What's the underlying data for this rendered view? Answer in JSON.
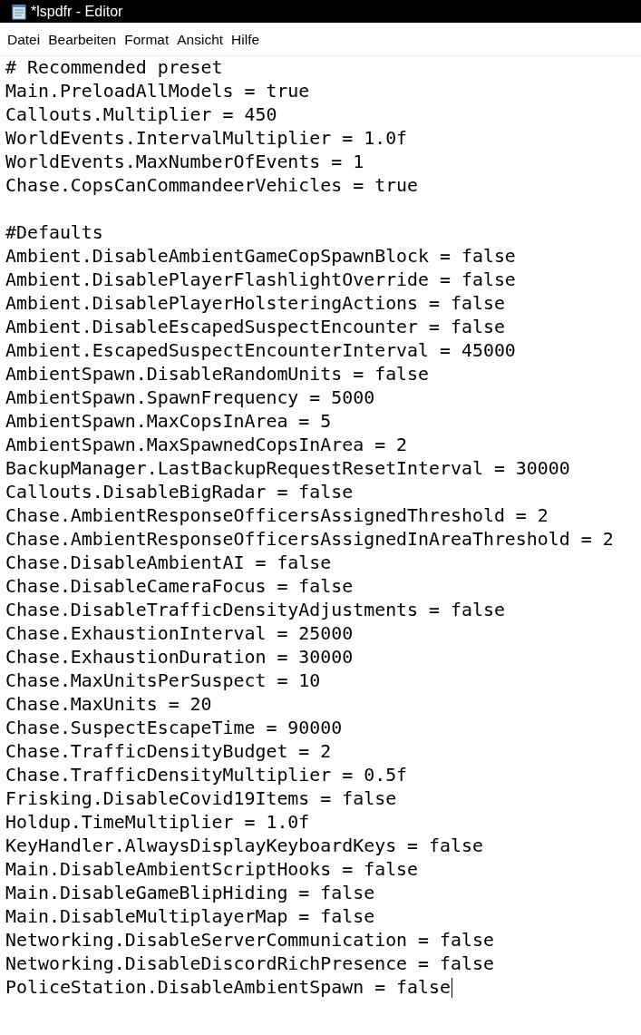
{
  "window": {
    "title": "*lspdfr - Editor"
  },
  "menu": [
    "Datei",
    "Bearbeiten",
    "Format",
    "Ansicht",
    "Hilfe"
  ],
  "editor": {
    "caret_visible": true,
    "sections": [
      {
        "lines": [
          "# Recommended preset",
          "Main.PreloadAllModels = true",
          "Callouts.Multiplier = 450",
          "WorldEvents.IntervalMultiplier = 1.0f",
          "WorldEvents.MaxNumberOfEvents = 1",
          "Chase.CopsCanCommandeerVehicles = true"
        ]
      },
      {
        "lines": [
          "#Defaults",
          "Ambient.DisableAmbientGameCopSpawnBlock = false",
          "Ambient.DisablePlayerFlashlightOverride = false",
          "Ambient.DisablePlayerHolsteringActions = false",
          "Ambient.DisableEscapedSuspectEncounter = false",
          "Ambient.EscapedSuspectEncounterInterval = 45000",
          "AmbientSpawn.DisableRandomUnits = false",
          "AmbientSpawn.SpawnFrequency = 5000",
          "AmbientSpawn.MaxCopsInArea = 5",
          "AmbientSpawn.MaxSpawnedCopsInArea = 2",
          "BackupManager.LastBackupRequestResetInterval = 30000",
          "Callouts.DisableBigRadar = false",
          "Chase.AmbientResponseOfficersAssignedThreshold = 2",
          "Chase.AmbientResponseOfficersAssignedInAreaThreshold = 2",
          "Chase.DisableAmbientAI = false",
          "Chase.DisableCameraFocus = false",
          "Chase.DisableTrafficDensityAdjustments = false",
          "Chase.ExhaustionInterval = 25000",
          "Chase.ExhaustionDuration = 30000",
          "Chase.MaxUnitsPerSuspect = 10",
          "Chase.MaxUnits = 20",
          "Chase.SuspectEscapeTime = 90000",
          "Chase.TrafficDensityBudget = 2",
          "Chase.TrafficDensityMultiplier = 0.5f",
          "Frisking.DisableCovid19Items = false",
          "Holdup.TimeMultiplier = 1.0f",
          "KeyHandler.AlwaysDisplayKeyboardKeys = false",
          "Main.DisableAmbientScriptHooks = false",
          "Main.DisableGameBlipHiding = false",
          "Main.DisableMultiplayerMap = false",
          "Networking.DisableServerCommunication = false",
          "Networking.DisableDiscordRichPresence = false",
          "PoliceStation.DisableAmbientSpawn = false"
        ]
      }
    ]
  }
}
